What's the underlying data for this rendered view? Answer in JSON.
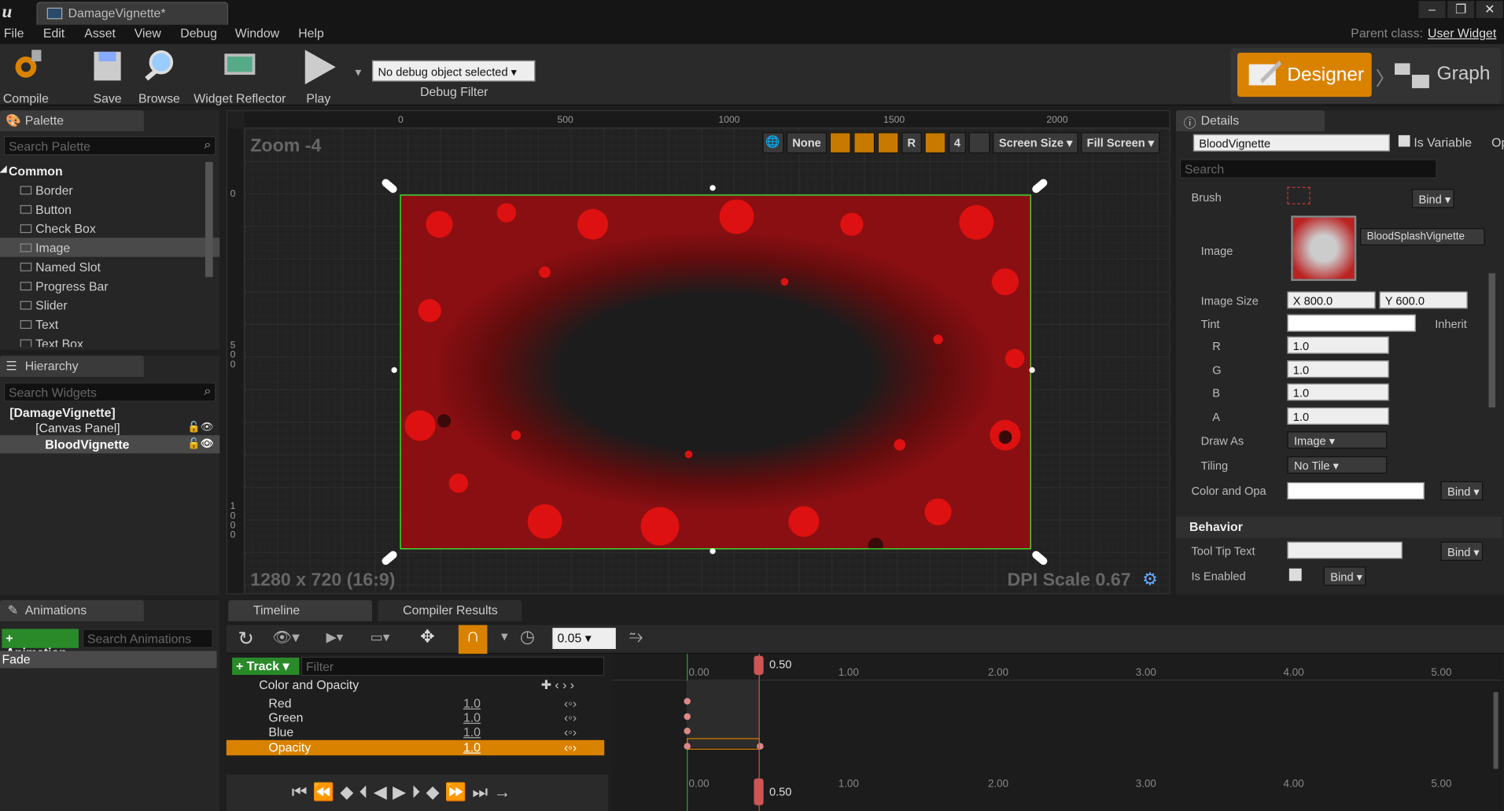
{
  "app": {
    "logo": "u",
    "doc_tab": "DamageVignette*",
    "parent_label": "Parent class:",
    "parent_value": "User Widget"
  },
  "window": {
    "minimize": "–",
    "restore": "❐",
    "close": "✕"
  },
  "menu": [
    "File",
    "Edit",
    "Asset",
    "View",
    "Debug",
    "Window",
    "Help"
  ],
  "toolbar": {
    "compile": "Compile",
    "save": "Save",
    "browse": "Browse",
    "widget_reflector": "Widget Reflector",
    "play": "Play",
    "debug_object": "No debug object selected",
    "debug_filter": "Debug Filter",
    "designer": "Designer",
    "graph": "Graph"
  },
  "palette": {
    "tab": "Palette",
    "search": "Search Palette",
    "category": "Common",
    "items": [
      "Border",
      "Button",
      "Check Box",
      "Image",
      "Named Slot",
      "Progress Bar",
      "Slider",
      "Text",
      "Text Box"
    ],
    "selected": "Image"
  },
  "hierarchy": {
    "tab": "Hierarchy",
    "search": "Search Widgets",
    "root": "[DamageVignette]",
    "canvas": "[Canvas Panel]",
    "child": "BloodVignette"
  },
  "viewport": {
    "zoom": "Zoom -4",
    "resolution": "1280 x 720 (16:9)",
    "dpi": "DPI Scale 0.67",
    "ruler_h": [
      "0",
      "500",
      "1000",
      "1500",
      "2000"
    ],
    "ruler_v": [
      "0",
      "500",
      "1000"
    ],
    "none_btn": "None",
    "grid_size": "4",
    "r_btn": "R",
    "screen_size": "Screen Size",
    "fill_screen": "Fill Screen"
  },
  "details": {
    "tab": "Details",
    "widget_name": "BloodVignette",
    "is_variable": "Is Variable",
    "search": "Search",
    "brush": "Brush",
    "bind": "Bind",
    "image_label": "Image",
    "image_asset": "BloodSplashVignette",
    "image_size": "Image Size",
    "size_x": "X  800.0",
    "size_y": "Y  600.0",
    "tint": "Tint",
    "inherit": "Inherit",
    "r": "R",
    "g": "G",
    "b": "B",
    "a": "A",
    "rv": "1.0",
    "gv": "1.0",
    "bv": "1.0",
    "av": "1.0",
    "draw_as": "Draw As",
    "draw_as_val": "Image",
    "tiling": "Tiling",
    "tiling_val": "No Tile",
    "color_opacity": "Color and Opa",
    "behavior": "Behavior",
    "tooltip": "Tool Tip Text",
    "is_enabled": "Is Enabled",
    "op": "Op"
  },
  "animations": {
    "tab": "Animations",
    "add": "+ Animation",
    "search": "Search Animations",
    "items": [
      "Fade"
    ]
  },
  "timeline": {
    "tab": "Timeline",
    "compiler": "Compiler Results",
    "step": "0.05",
    "add_track": "+ Track",
    "filter": "Filter",
    "group": "Color and Opacity",
    "tracks": [
      {
        "name": "Red",
        "value": "1.0"
      },
      {
        "name": "Green",
        "value": "1.0"
      },
      {
        "name": "Blue",
        "value": "1.0"
      },
      {
        "name": "Opacity",
        "value": "1.0"
      }
    ],
    "playhead": "0.50",
    "times": [
      "0.00",
      "1.00",
      "2.00",
      "3.00",
      "4.00",
      "5.00"
    ],
    "start": "0.00"
  }
}
